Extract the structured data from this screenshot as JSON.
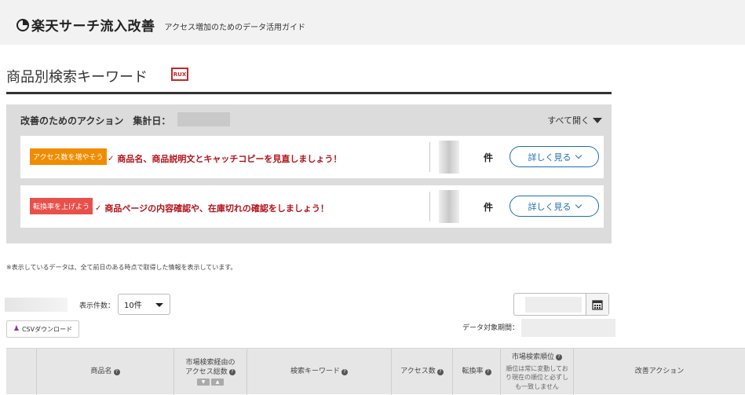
{
  "header": {
    "title": "楽天サーチ流入改善",
    "subtitle": "アクセス増加のためのデータ活用ガイド",
    "logo_icon": "pie-chart-icon"
  },
  "page": {
    "title": "商品別検索キーワード",
    "badge": "RUX"
  },
  "action_panel": {
    "heading": "改善のためのアクション　集計日：",
    "open_all": "すべて開く",
    "rows": [
      {
        "tag": "アクセス数を増やそう",
        "tag_color": "#f08c00",
        "text": "商品名、商品説明文とキャッチコピーを見直しましょう！",
        "count_unit": "件",
        "button": "詳しく見る"
      },
      {
        "tag": "転換率を上げよう",
        "tag_color": "#e9504b",
        "text": "商品ページの内容確認や、在庫切れの確認をしましょう！",
        "count_unit": "件",
        "button": "詳しく見る"
      }
    ]
  },
  "note": "※表示しているデータは、全て前日のある時点で取得した情報を表示しています。",
  "controls": {
    "per_page_label": "表示件数：",
    "per_page_value": "10件",
    "csv_button": "CSVダウンロード",
    "period_label": "データ対象期間："
  },
  "table": {
    "headers": {
      "product": "商品名",
      "market_access_line1": "市場検索経由の",
      "market_access_line2": "アクセス総数",
      "keyword": "検索キーワード",
      "access": "アクセス数",
      "conversion": "転換率",
      "rank": "市場検索順位",
      "rank_note": "順位は常に変動してお り現在の順位と必ずし も一致しません",
      "action": "改善アクション"
    }
  },
  "colors": {
    "accent_blue": "#1f6fb2",
    "alert_red": "#b5121b",
    "panel_bg": "#dcdcdc"
  }
}
